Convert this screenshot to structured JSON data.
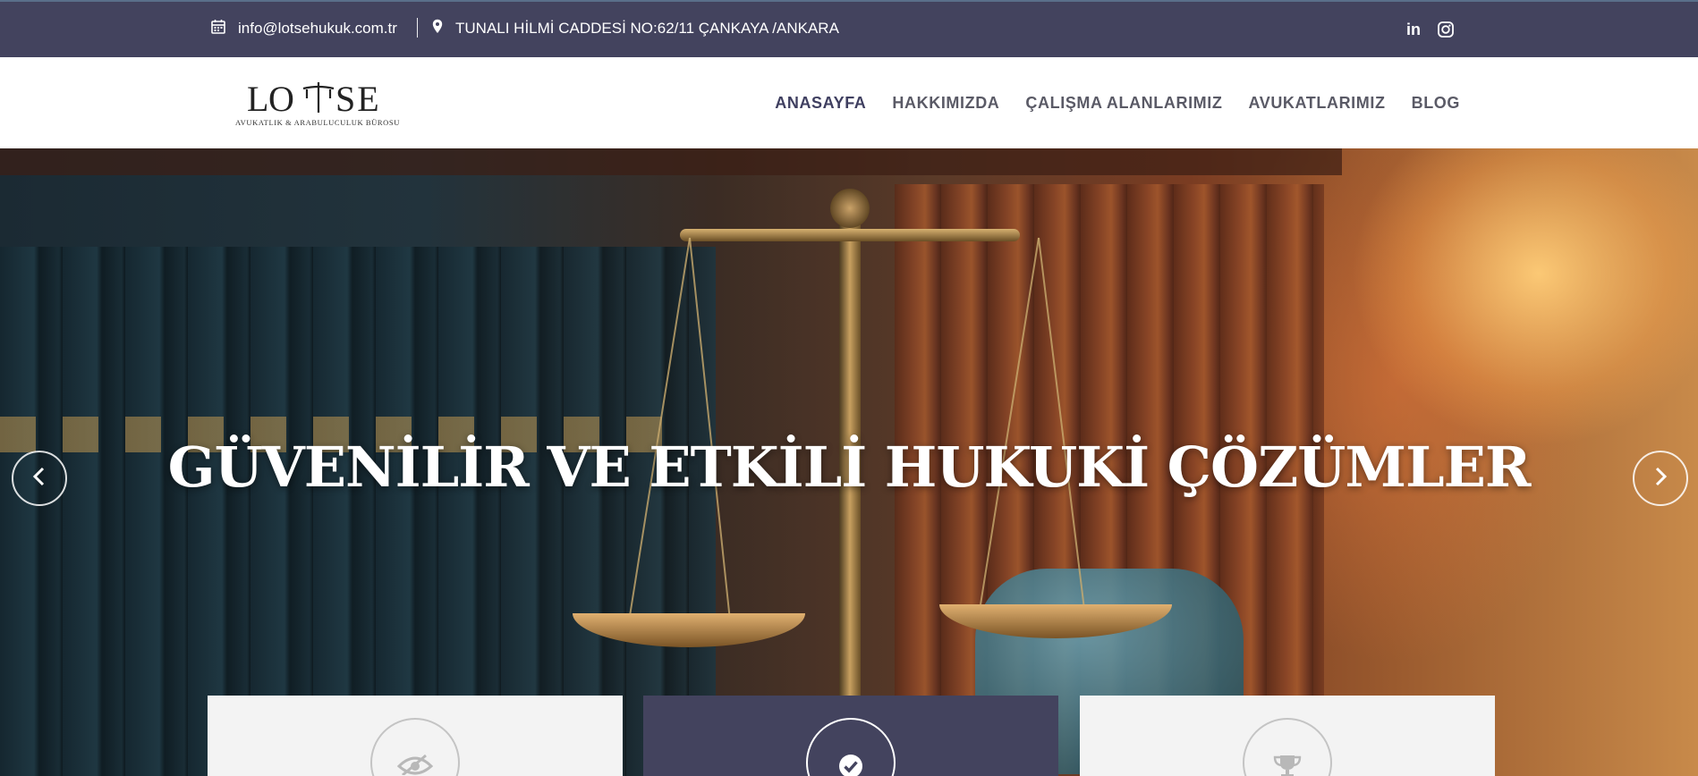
{
  "topbar": {
    "email": "info@lotsehukuk.com.tr",
    "address": "TUNALI HİLMİ CADDESİ NO:62/11 ÇANKAYA /ANKARA",
    "social": {
      "linkedin_label": "in",
      "icons": [
        "linkedin-icon",
        "instagram-icon"
      ]
    }
  },
  "header": {
    "logo": {
      "word": "LOTSE",
      "subtitle": "AVUKATLIK & ARABULUCULUK BÜROSU"
    },
    "nav": [
      {
        "label": "ANASAYFA",
        "active": true
      },
      {
        "label": "HAKKIMIZDA",
        "active": false
      },
      {
        "label": "ÇALIŞMA ALANLARIMIZ",
        "active": false
      },
      {
        "label": "AVUKATLARIMIZ",
        "active": false
      },
      {
        "label": "BLOG",
        "active": false
      }
    ]
  },
  "hero": {
    "title": "GÜVENİLİR VE ETKİLİ HUKUKİ ÇÖZÜMLER",
    "controls": [
      "chevron-left-icon",
      "chevron-right-icon"
    ]
  },
  "features": [
    {
      "icon": "eye-icon"
    },
    {
      "icon": "check-circle-icon"
    },
    {
      "icon": "trophy-icon"
    }
  ],
  "colors": {
    "primary": "#43435e",
    "topbar_text": "#ffffff",
    "nav_text": "#5a5a66",
    "feature_light": "#f3f3f3"
  }
}
